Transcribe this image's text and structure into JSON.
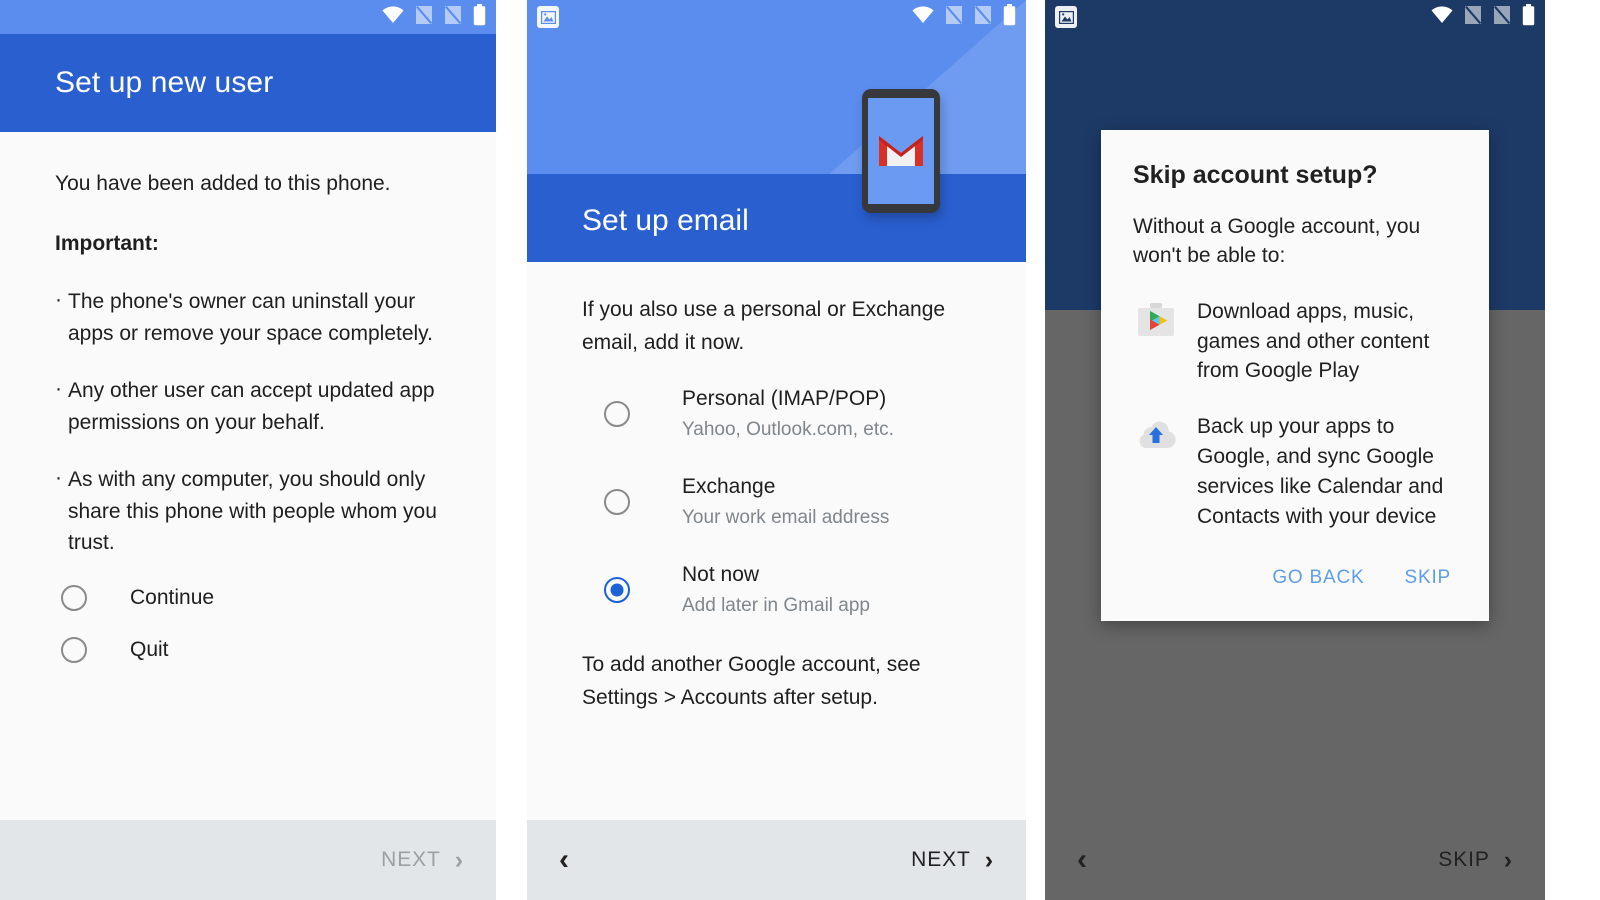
{
  "panels": [
    {
      "name": "set-up-new-user",
      "statusbar": {
        "icons": [
          "wifi-icon",
          "no-sim-icon",
          "no-sim-icon",
          "battery-icon"
        ]
      },
      "header": {
        "title": "Set up new user"
      },
      "lead": "You have been added to this phone.",
      "important_label": "Important:",
      "bullets": [
        "The phone's owner can uninstall your apps or remove your space completely.",
        "Any other user can accept updated app permissions on your behalf.",
        "As with any computer, you should only share this phone with people whom you trust."
      ],
      "options": [
        {
          "label": "Continue",
          "selected": false
        },
        {
          "label": "Quit",
          "selected": false
        }
      ],
      "nav": {
        "next_label": "NEXT",
        "next_enabled": false,
        "back_visible": false
      }
    },
    {
      "name": "set-up-email",
      "statusbar": {
        "notification_icon": "screenshot-image-icon",
        "icons": [
          "wifi-icon",
          "no-sim-icon",
          "no-sim-icon",
          "battery-icon"
        ]
      },
      "hero": {
        "title": "Set up email",
        "illustration": "gmail-on-tablet-illustration"
      },
      "lead": "If you also use a personal or Exchange email, add it now.",
      "options": [
        {
          "label": "Personal (IMAP/POP)",
          "sublabel": "Yahoo, Outlook.com, etc.",
          "selected": false
        },
        {
          "label": "Exchange",
          "sublabel": "Your work email address",
          "selected": false
        },
        {
          "label": "Not now",
          "sublabel": "Add later in Gmail app",
          "selected": true
        }
      ],
      "footnote": "To add another Google account, see Settings > Accounts after setup.",
      "nav": {
        "next_label": "NEXT",
        "next_enabled": true,
        "back_visible": true
      }
    },
    {
      "name": "skip-account-setup",
      "statusbar": {
        "notification_icon": "screenshot-image-icon",
        "icons": [
          "wifi-icon",
          "no-sim-icon",
          "no-sim-icon",
          "battery-icon"
        ]
      },
      "dialog": {
        "title": "Skip account setup?",
        "subtitle": "Without a Google account, you won't be able to:",
        "benefits": [
          {
            "icon": "google-play-briefcase-icon",
            "text": "Download apps, music, games and other content from Google Play"
          },
          {
            "icon": "cloud-backup-icon",
            "text": "Back up your apps to Google, and sync Google services like Calendar and Contacts with your device"
          }
        ],
        "buttons": [
          {
            "label": "GO BACK",
            "name": "go-back-button"
          },
          {
            "label": "SKIP",
            "name": "skip-button"
          }
        ]
      },
      "nav": {
        "next_label": "SKIP",
        "next_enabled": true,
        "back_visible": true
      }
    }
  ],
  "colors": {
    "header_blue": "#2a5fd0",
    "status_blue": "#5b8dee",
    "navy": "#1d3a67",
    "scrim_gray": "#666666",
    "accent_blue": "#1a62d6",
    "link_blue": "#5f9de8",
    "disabled_gray": "#9aa0a6",
    "surface": "#fafafa"
  }
}
